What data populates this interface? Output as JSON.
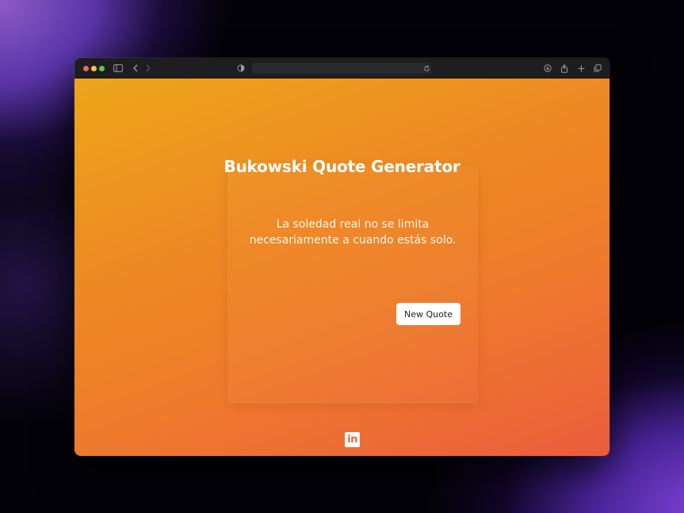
{
  "browser": {
    "address_text": "",
    "icons": [
      "sidebar-icon",
      "back-icon",
      "forward-icon",
      "privacy-shield-icon",
      "reload-icon",
      "download-icon",
      "share-icon",
      "new-tab-icon",
      "tab-overview-icon"
    ]
  },
  "app": {
    "title": "Bukowski Quote Generator",
    "quote_line1": "La soledad real no se limita",
    "quote_line2": "necesariamente a cuando estás solo.",
    "button_label": "New Quote",
    "footer_icon": "linkedin-icon",
    "linkedin_text": "in"
  },
  "colors": {
    "gradient_start": "#eda51a",
    "gradient_end": "#ec5c3c",
    "button_bg": "#ffffff",
    "text": "#ffffff"
  }
}
